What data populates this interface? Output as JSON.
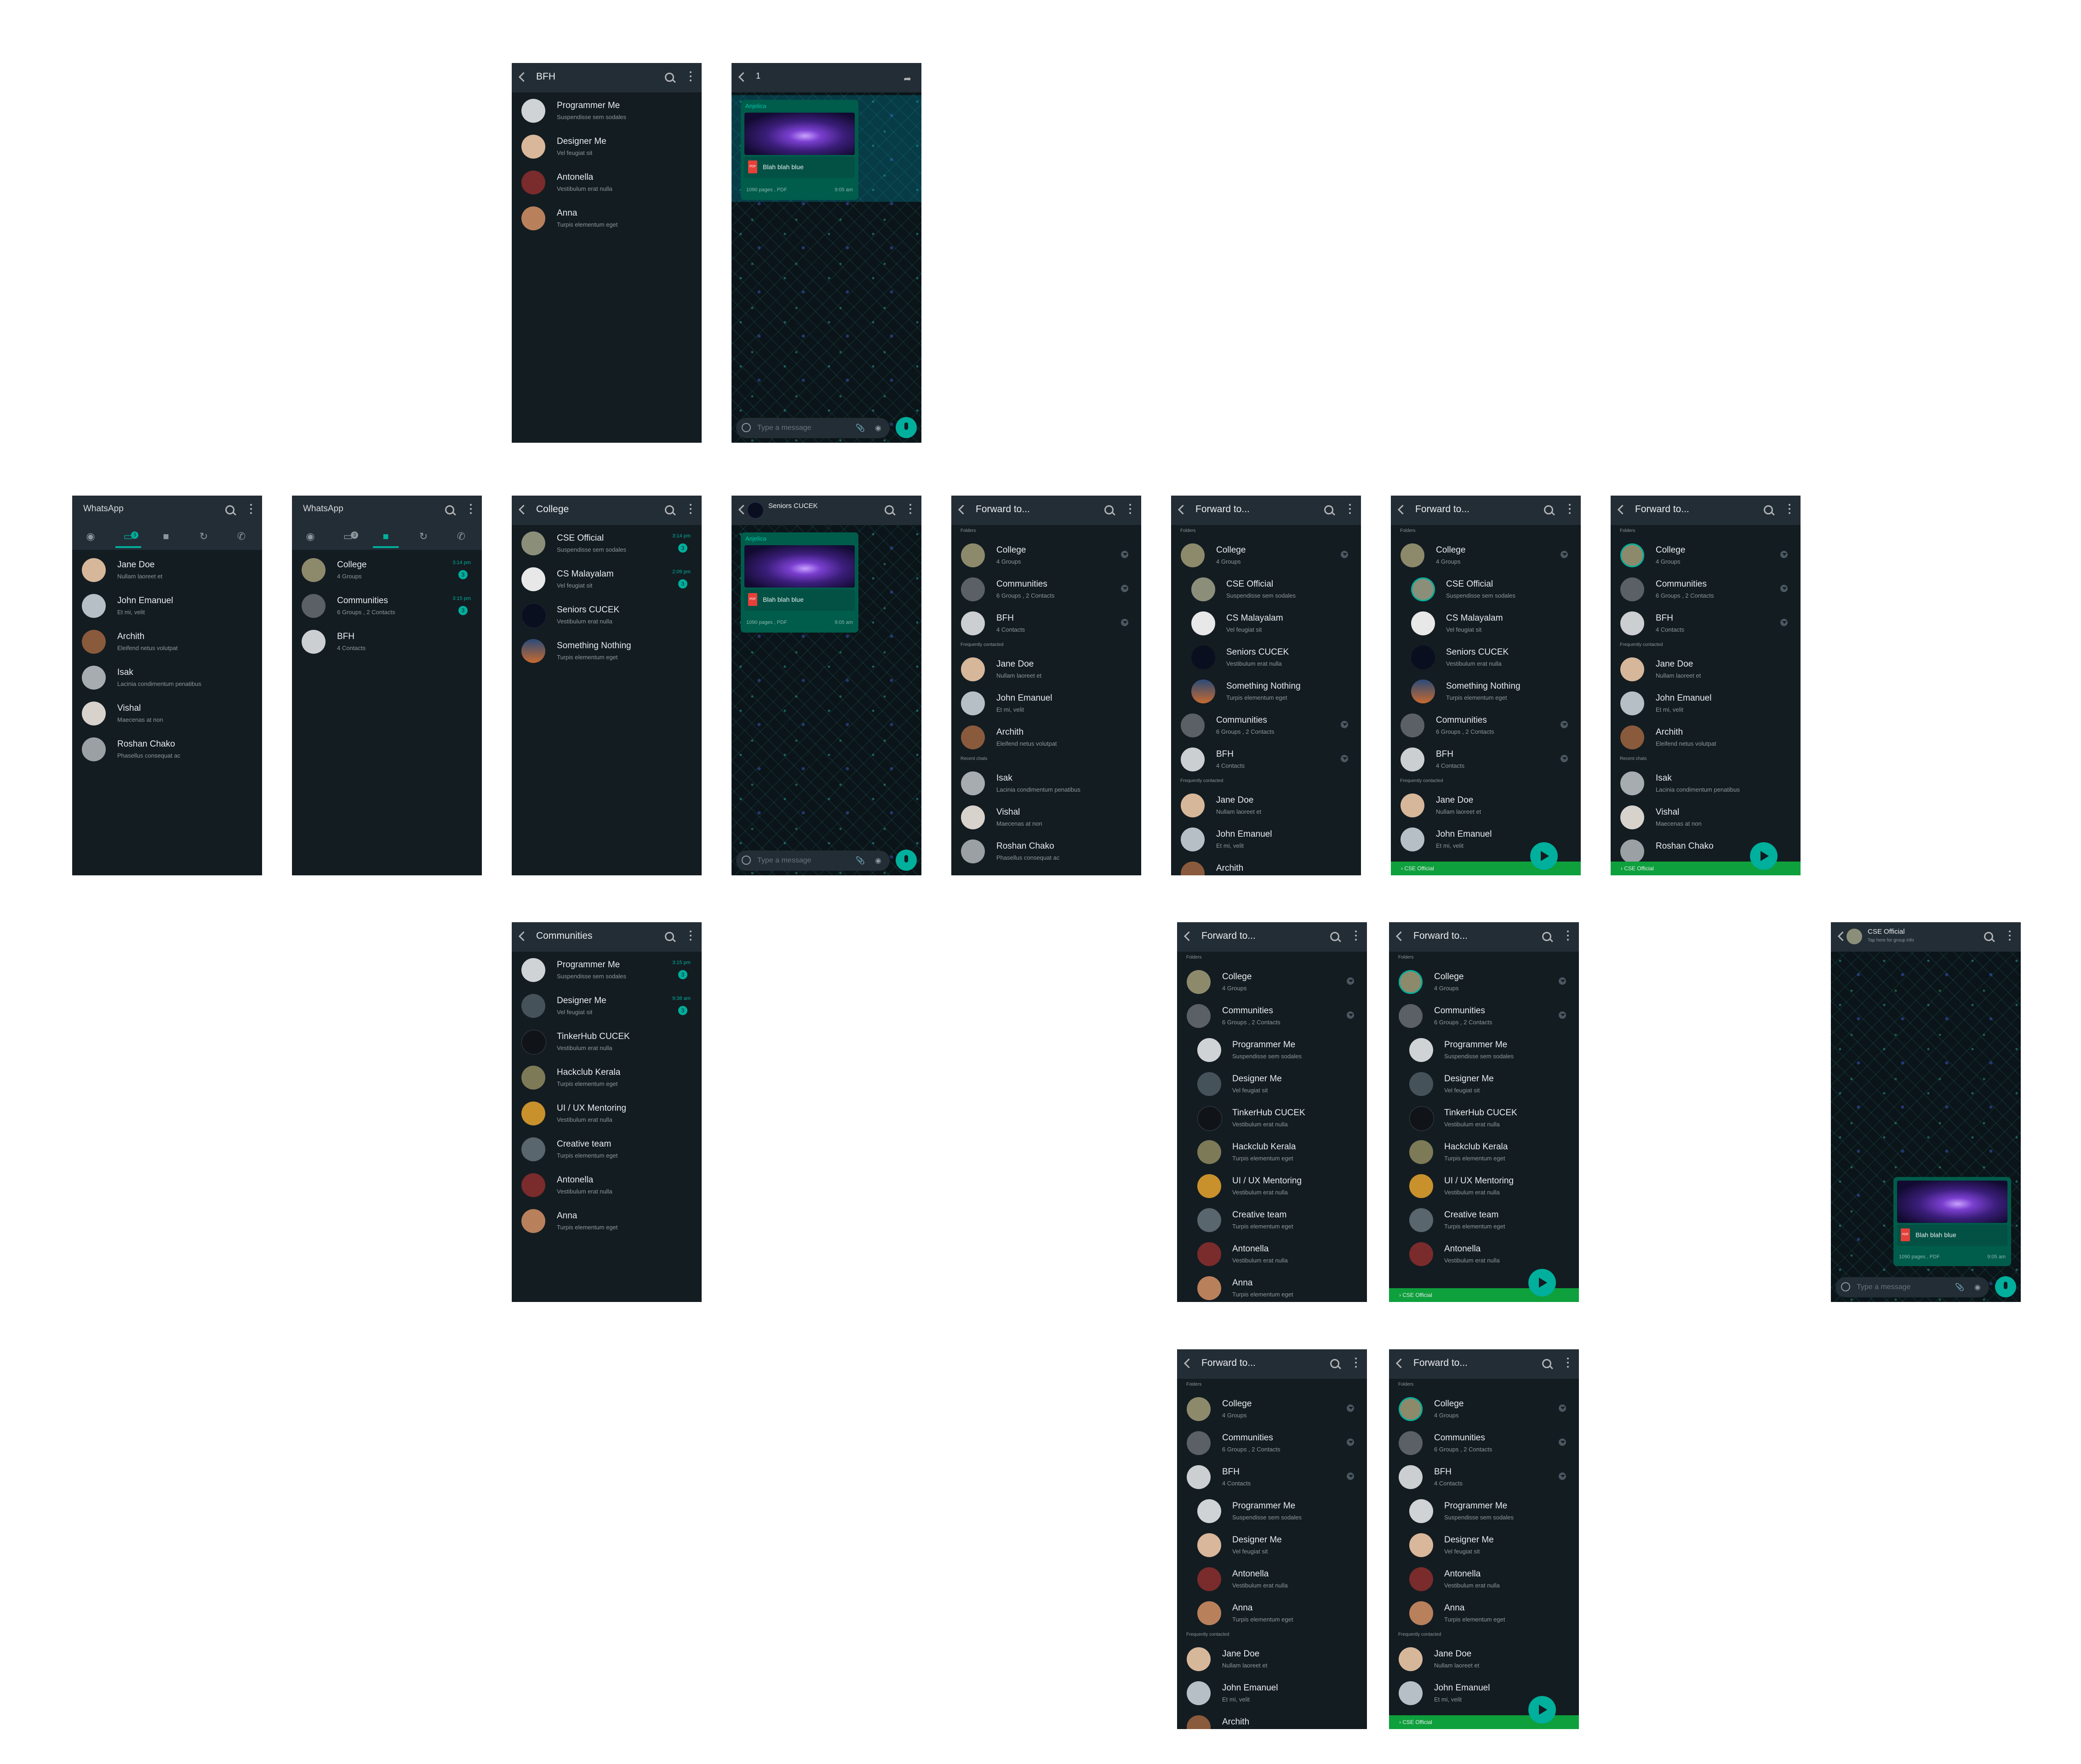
{
  "header_titles": {
    "bfh": "BFH",
    "chat_count": "1",
    "whatsapp": "WhatsApp",
    "college": "College",
    "seniors": "Seniors CUCEK",
    "forward": "Forward to...",
    "communities": "Communities",
    "cse": "CSE Official",
    "cse_sub": "Tap here for group info"
  },
  "tab_badges": {
    "chats": "3",
    "chats_dim": "3"
  },
  "contacts": {
    "jane": {
      "name": "Jane Doe",
      "sub": "Nullam laoreet et"
    },
    "john": {
      "name": "John Emanuel",
      "sub": "Et mi, velit"
    },
    "archith": {
      "name": "Archith",
      "sub": "Eleifend netus volutpat"
    },
    "isak": {
      "name": "Isak",
      "sub": "Lacinia condimentum penatibus"
    },
    "vishal": {
      "name": "Vishal",
      "sub": "Maecenas at non"
    },
    "roshan": {
      "name": "Roshan Chako",
      "sub": "Phasellus consequat ac"
    },
    "programmer": {
      "name": "Programmer Me",
      "sub": "Suspendisse sem sodales"
    },
    "designer": {
      "name": "Designer Me",
      "sub": "Vel feugiat sit"
    },
    "antonella": {
      "name": "Antonella",
      "sub": "Vestibulum erat nulla"
    },
    "anna": {
      "name": "Anna",
      "sub": "Turpis elementum eget"
    },
    "college": {
      "name": "College",
      "sub": "4 Groups"
    },
    "communities": {
      "name": "Communities",
      "sub": "6 Groups , 2 Contacts"
    },
    "bfh": {
      "name": "BFH",
      "sub": "4 Contacts"
    },
    "cse": {
      "name": "CSE Official",
      "sub": "Suspendisse sem sodales"
    },
    "csmal": {
      "name": "CS Malayalam",
      "sub": "Vel feugiat sit"
    },
    "seniors": {
      "name": "Seniors CUCEK",
      "sub": "Vestibulum erat nulla"
    },
    "something": {
      "name": "Something Nothing",
      "sub": "Turpis elementum eget"
    },
    "tinker": {
      "name": "TinkerHub CUCEK",
      "sub": "Vestibulum erat nulla"
    },
    "hackclub": {
      "name": "Hackclub Kerala",
      "sub": "Turpis elementum eget"
    },
    "uiux": {
      "name": "UI / UX Mentoring",
      "sub": "Vestibulum erat nulla"
    },
    "creative": {
      "name": "Creative team",
      "sub": "Turpis elementum eget"
    }
  },
  "times": {
    "college": "3:14 pm",
    "communities": "3:15 pm",
    "cse": "3:14 pm",
    "csmal": "2:09 pm",
    "programmer": "3:15 pm",
    "designer": "9:38 am"
  },
  "badges": {
    "college": "3",
    "communities": "3",
    "cse": "3",
    "csmal": "3",
    "programmer": "3",
    "designer": "3"
  },
  "sections": {
    "folders": "Folders",
    "frequent": "Frequently contacted",
    "recent": "Recent chats"
  },
  "message": {
    "sender": "Anjelica",
    "file": "Blah blah blue",
    "pdf_icon": "PDF",
    "meta": "1090 pages , PDF",
    "time": "9:05 am",
    "placeholder": "Type a message"
  },
  "forward_target": "CSE Official",
  "colors": {
    "accent": "#00af9c",
    "header": "#232d36",
    "background": "#131c21",
    "bubble": "#005c4b",
    "forward_bar": "#0ea03c"
  },
  "icons": [
    "back-arrow-icon",
    "search-icon",
    "more-vert-icon",
    "camera-icon",
    "chat-icon",
    "folder-icon",
    "status-icon",
    "call-icon",
    "share-icon",
    "chevron-down-icon",
    "send-icon",
    "mic-icon",
    "emoji-icon",
    "attach-icon",
    "pdf-icon"
  ]
}
